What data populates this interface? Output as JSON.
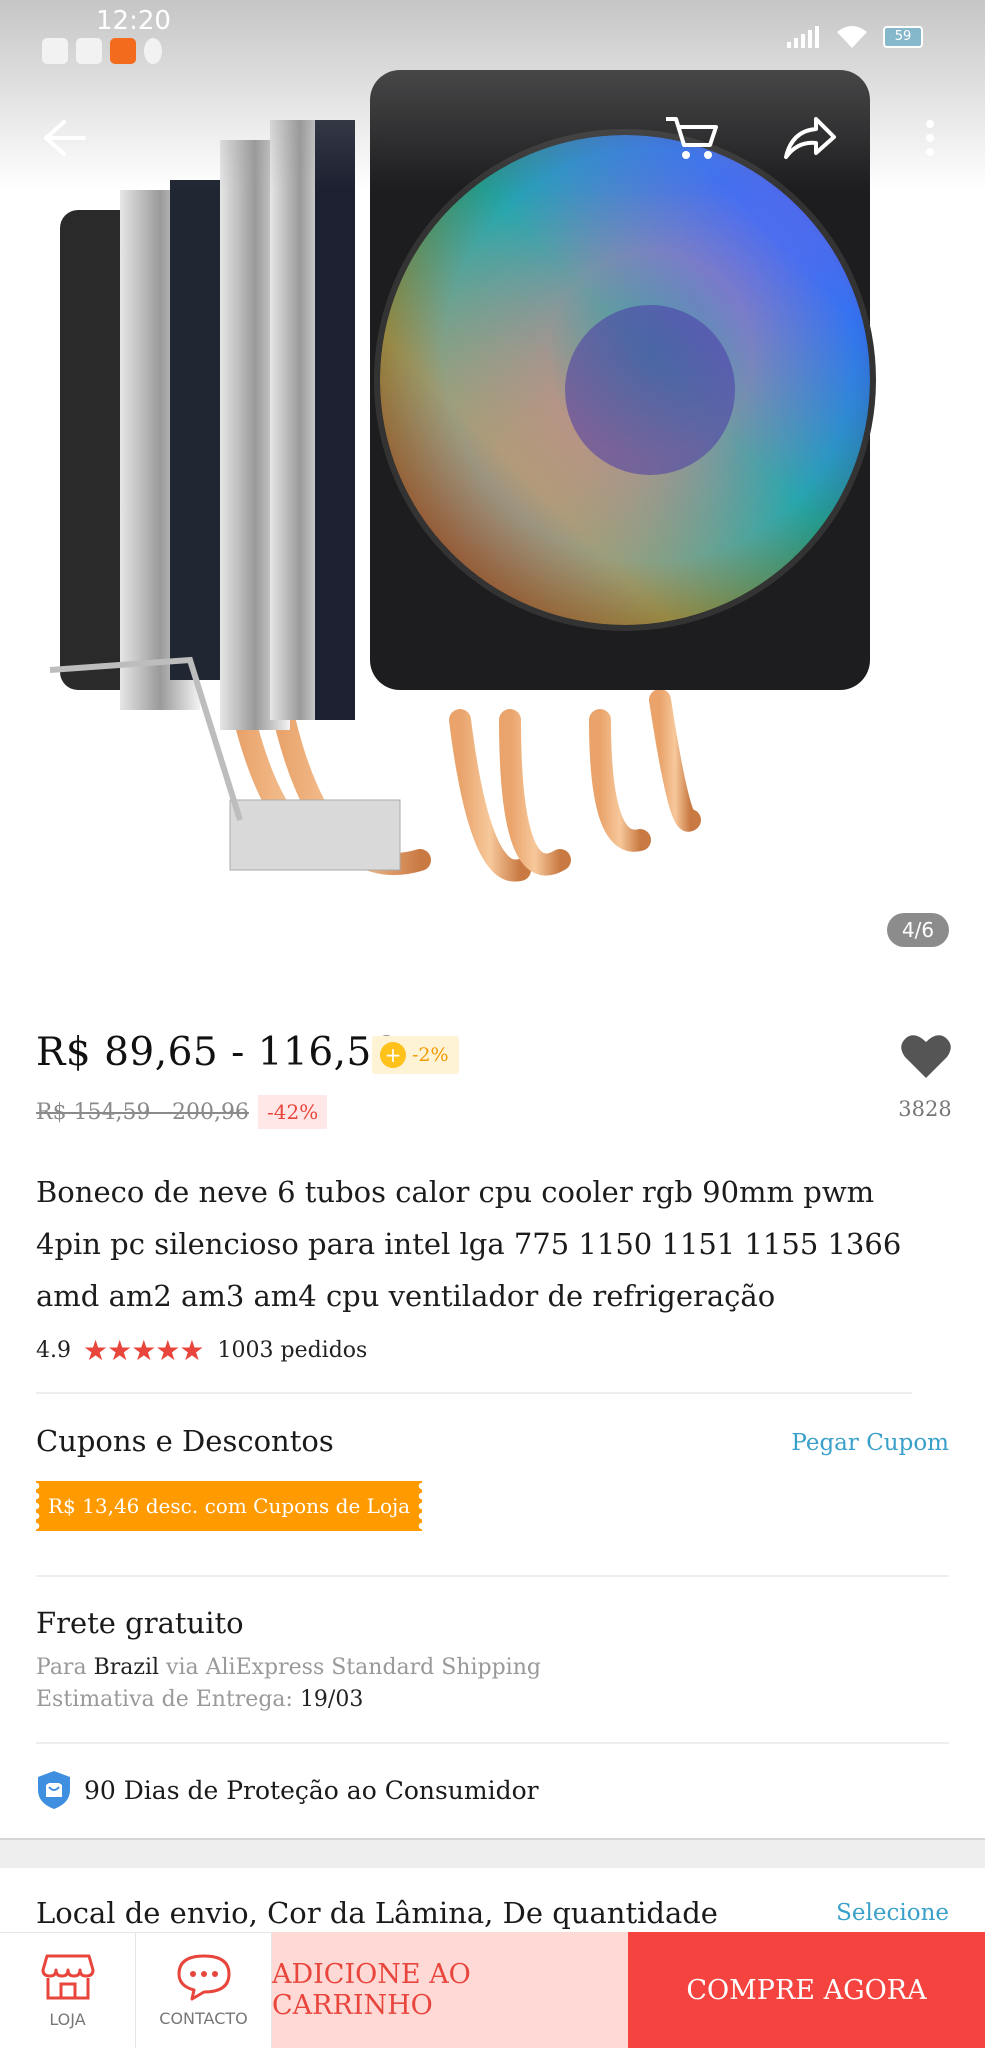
{
  "status_bar": {
    "time": "12:20",
    "battery": "59"
  },
  "gallery": {
    "counter": "4/6"
  },
  "price": {
    "current": "R$ 89,65 - 116,56",
    "coin_discount": "-2%",
    "original": "R$ 154,59 - 200,96",
    "discount": "-42%"
  },
  "wishlist": {
    "count": "3828"
  },
  "product": {
    "title": "Boneco de neve 6 tubos calor cpu cooler rgb 90mm pwm 4pin pc silencioso para intel lga 775 1150 1151 1155 1366 amd am2 am3 am4 cpu ventilador de refrigeração",
    "rating": "4.9",
    "stars": "★★★★★",
    "orders": "1003 pedidos"
  },
  "coupons": {
    "title": "Cupons e Descontos",
    "action": "Pegar Cupom",
    "coupon_text": "R$ 13,46 desc. com Cupons de Loja"
  },
  "shipping": {
    "title": "Frete gratuito",
    "to_prefix": "Para",
    "country": "Brazil",
    "via": "via AliExpress Standard Shipping",
    "estimate_label": "Estimativa de Entrega:",
    "estimate_date": "19/03"
  },
  "protection": {
    "text": "90 Dias de Proteção ao Consumidor"
  },
  "options": {
    "title": "Local de envio, Cor da Lâmina, De quantidade",
    "action": "Selecione"
  },
  "bottom_bar": {
    "store_label": "LOJA",
    "contact_label": "CONTACTO",
    "add_to_cart": "ADICIONE AO CARRINHO",
    "buy_now": "COMPRE AGORA"
  },
  "colors": {
    "accent_red": "#f5433f",
    "link_blue": "#3aa0c9",
    "coupon_orange": "#ff9a00"
  }
}
